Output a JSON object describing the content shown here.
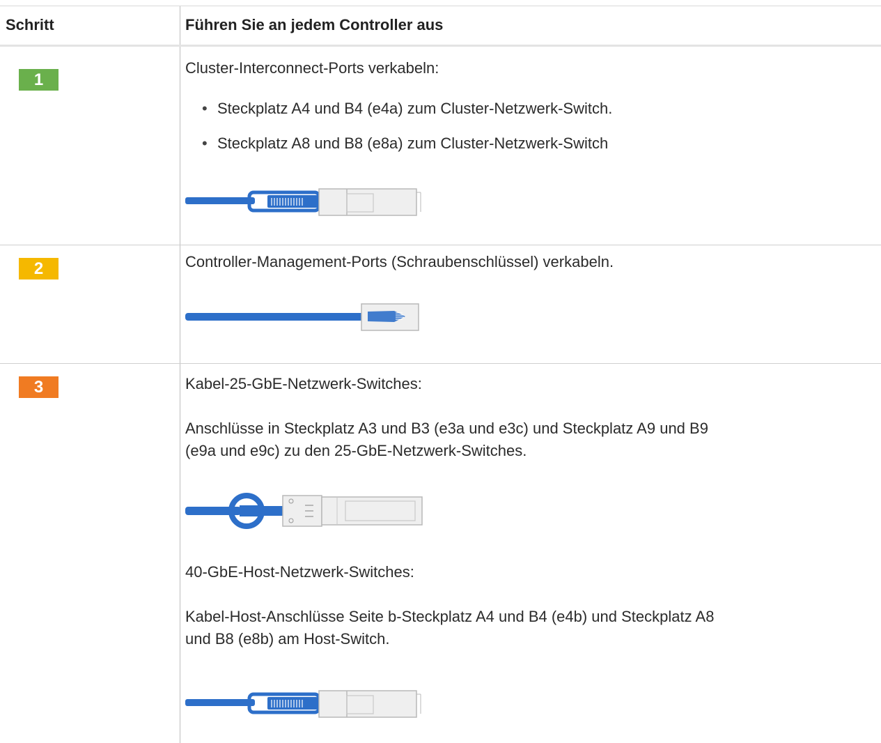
{
  "header": {
    "col_step": "Schritt",
    "col_action": "Führen Sie an jedem Controller aus"
  },
  "colors": {
    "step1": "#6ab04c",
    "step2": "#f5b800",
    "step3": "#f07b22",
    "cable_blue": "#2d6fc9"
  },
  "rows": [
    {
      "step": "1",
      "title": "Cluster-Interconnect-Ports verkabeln:",
      "bullets": [
        "Steckplatz A4 und B4 (e4a) zum Cluster-Netzwerk-Switch.",
        "Steckplatz A8 und B8 (e8a) zum Cluster-Netzwerk-Switch"
      ],
      "cable_icon": "qsfp-cable-icon"
    },
    {
      "step": "2",
      "title": "Controller-Management-Ports (Schraubenschlüssel) verkabeln.",
      "cable_icon": "rj45-cable-icon"
    },
    {
      "step": "3",
      "title": "Kabel-25-GbE-Netzwerk-Switches:",
      "para1_line1": "Anschlüsse in Steckplatz A3 und B3 (e3a und e3c) und Steckplatz A9 und B9",
      "para1_line2": "(e9a und e9c) zu den 25-GbE-Netzwerk-Switches.",
      "cable1_icon": "sfp28-cable-icon",
      "subtitle": "40-GbE-Host-Netzwerk-Switches:",
      "para2_line1": "Kabel-Host-Anschlüsse Seite b-Steckplatz A4 und B4 (e4b) und Steckplatz A8",
      "para2_line2": "und B8 (e8b) am Host-Switch.",
      "cable2_icon": "qsfp-cable-icon"
    }
  ]
}
